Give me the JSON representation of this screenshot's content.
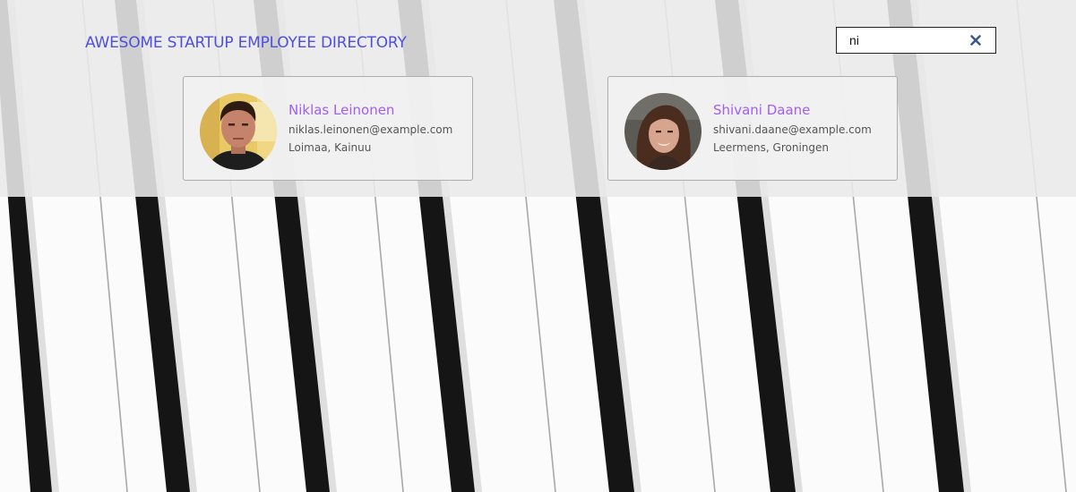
{
  "header": {
    "title": "AWESOME STARTUP EMPLOYEE DIRECTORY"
  },
  "search": {
    "value": "ni",
    "clear_icon": "close-icon"
  },
  "employees": [
    {
      "name": "Niklas Leinonen",
      "email": "niklas.leinonen@example.com",
      "location": "Loimaa, Kainuu",
      "avatar": "avatar-photo"
    },
    {
      "name": "Shivani Daane",
      "email": "shivani.daane@example.com",
      "location": "Leermens, Groningen",
      "avatar": "avatar-photo"
    }
  ],
  "colors": {
    "title": "#4f4fdb",
    "name": "#a15ef0",
    "clear_icon": "#3b5a8a"
  }
}
